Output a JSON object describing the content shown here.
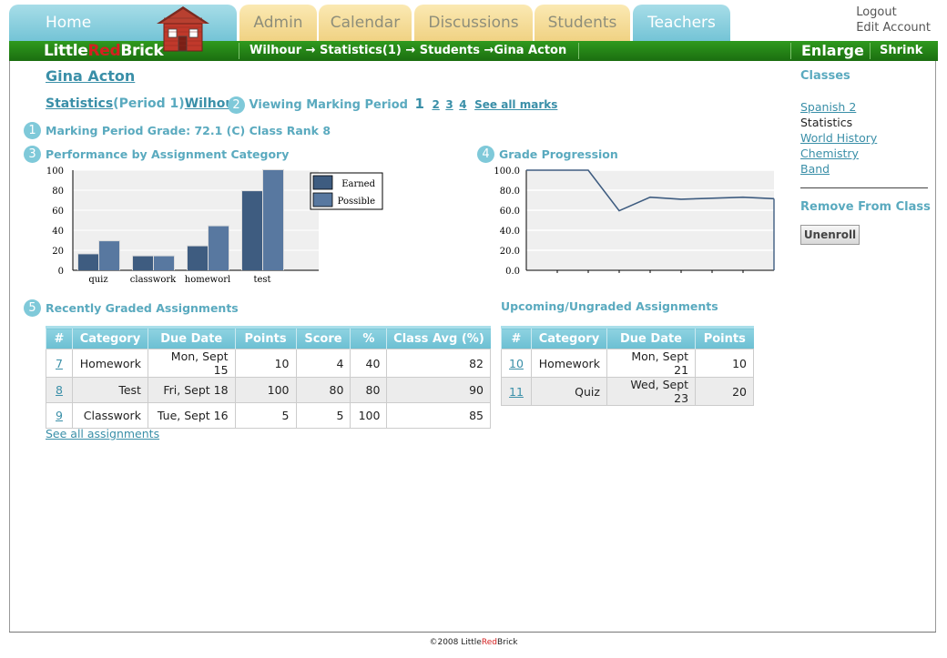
{
  "nav": {
    "tabs": [
      {
        "label": "Home",
        "style": "blue"
      },
      {
        "label": "Admin",
        "style": "yellow"
      },
      {
        "label": "Calendar",
        "style": "yellow"
      },
      {
        "label": "Discussions",
        "style": "yellow"
      },
      {
        "label": "Students",
        "style": "yellow"
      },
      {
        "label": "Teachers",
        "style": "blue"
      }
    ],
    "logout": "Logout",
    "edit_account": "Edit Account"
  },
  "brand": {
    "part1": "Little",
    "part2": "Red",
    "part3": "Brick"
  },
  "breadcrumb": "Wilhour → Statistics(1) → Students →Gina Acton",
  "enlarge": "Enlarge",
  "shrink": "Shrink",
  "student_name": "Gina Acton",
  "class_line": {
    "class_link": "Statistics",
    "period": "(Period 1)",
    "teacher_link": "Wilhour"
  },
  "marking": {
    "num": "2",
    "label": "Viewing Marking Period",
    "current": "1",
    "others": [
      "2",
      "3",
      "4"
    ],
    "see_all": "See all marks"
  },
  "sections": {
    "grade": {
      "num": "1",
      "label": "Marking Period Grade: 72.1 (C) Class Rank 8"
    },
    "performance": {
      "num": "3",
      "label": "Performance by Assignment Category"
    },
    "progression": {
      "num": "4",
      "label": "Grade Progression"
    },
    "recent": {
      "num": "5",
      "label": "Recently Graded Assignments"
    },
    "upcoming": {
      "label": "Upcoming/Ungraded Assignments"
    }
  },
  "chart_data": [
    {
      "type": "bar",
      "categories": [
        "quiz",
        "classwork",
        "homeworl",
        "test"
      ],
      "series": [
        {
          "name": "Earned",
          "values": [
            16,
            14,
            24,
            79
          ],
          "color": "#3e5c80"
        },
        {
          "name": "Possible",
          "values": [
            29,
            14,
            44,
            100
          ],
          "color": "#5878a0"
        }
      ],
      "ylim": [
        0,
        100
      ],
      "yticks": [
        "100",
        "80",
        "60",
        "40",
        "20",
        "0"
      ],
      "legend": "top-right",
      "grid": true
    },
    {
      "type": "line",
      "series": [
        {
          "values": [
            100,
            100,
            100,
            59.5,
            73,
            71,
            72,
            73,
            71.5
          ],
          "color": "#3e5c80"
        }
      ],
      "ylim": [
        0,
        100
      ],
      "yticks": [
        "100.0",
        "80.0",
        "60.0",
        "40.0",
        "20.0",
        "0.0"
      ],
      "grid": true
    }
  ],
  "recent_table": {
    "headers": [
      "#",
      "Category",
      "Due Date",
      "Points",
      "Score",
      "%",
      "Class Avg (%)"
    ],
    "rows": [
      [
        "7",
        "Homework",
        "Mon, Sept 15",
        "10",
        "4",
        "40",
        "82"
      ],
      [
        "8",
        "Test",
        "Fri, Sept 18",
        "100",
        "80",
        "80",
        "90"
      ],
      [
        "9",
        "Classwork",
        "Tue, Sept 16",
        "5",
        "5",
        "100",
        "85"
      ]
    ]
  },
  "see_all_assignments": "See all assignments",
  "upcoming_table": {
    "headers": [
      "#",
      "Category",
      "Due Date",
      "Points"
    ],
    "rows": [
      [
        "10",
        "Homework",
        "Mon, Sept 21",
        "10"
      ],
      [
        "11",
        "Quiz",
        "Wed, Sept 23",
        "20"
      ]
    ]
  },
  "sidebar": {
    "classes_title": "Classes",
    "classes": [
      {
        "name": "Spanish 2",
        "link": true
      },
      {
        "name": "Statistics",
        "link": false
      },
      {
        "name": "World History",
        "link": true
      },
      {
        "name": "Chemistry",
        "link": true
      },
      {
        "name": "Band",
        "link": true
      }
    ],
    "remove_title": "Remove From Class",
    "unenroll": "Unenroll"
  },
  "footer": {
    "copyright": "©2008 ",
    "part1": "Little",
    "part2": "Red",
    "part3": "Brick"
  }
}
